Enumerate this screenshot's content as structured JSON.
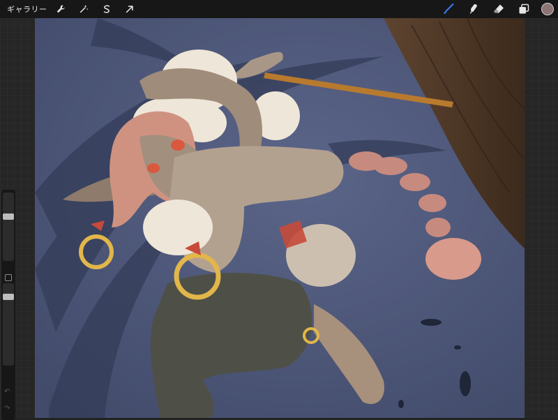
{
  "topbar": {
    "gallery_label": "ギャラリー",
    "left_tools": [
      {
        "icon": "wrench-icon"
      },
      {
        "icon": "magic-wand-icon"
      },
      {
        "icon": "selection-icon"
      },
      {
        "icon": "transform-arrow-icon"
      }
    ],
    "right_tools": [
      {
        "icon": "brush-icon",
        "active": true
      },
      {
        "icon": "smudge-icon"
      },
      {
        "icon": "eraser-icon"
      },
      {
        "icon": "layers-icon"
      }
    ],
    "current_color": "#8c7374"
  },
  "sidebar": {
    "brush_size": 0.35,
    "opacity": 0.95
  },
  "colors": {
    "accent": "#3c7cf4",
    "canvas_bg": "#4a5474"
  }
}
